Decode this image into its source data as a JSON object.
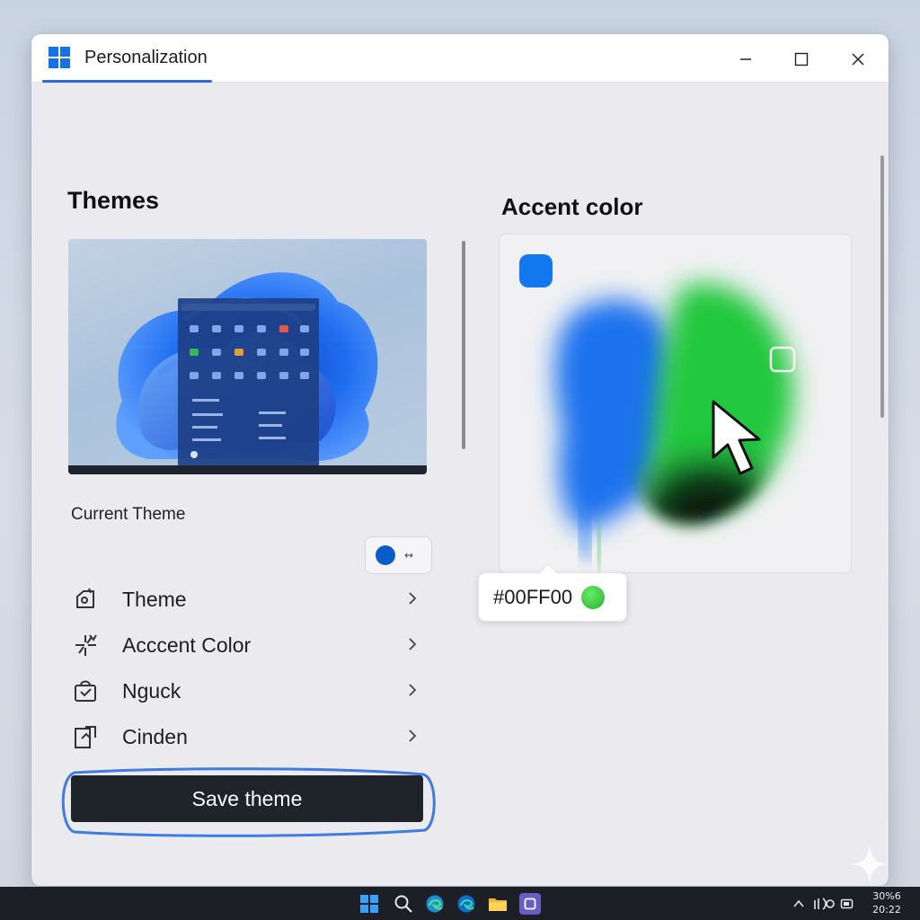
{
  "window": {
    "title": "Personalization"
  },
  "left": {
    "section_title": "Themes",
    "current_theme_label": "Current Theme",
    "chip_color": "#0a5cc9",
    "menu": [
      {
        "label": "Theme",
        "icon": "theme-paint-icon"
      },
      {
        "label": "Acccent Color",
        "icon": "accent-color-icon"
      },
      {
        "label": "Nguck",
        "icon": "bag-icon"
      },
      {
        "label": "Cinden",
        "icon": "window-export-icon"
      }
    ],
    "save_label": "Save theme"
  },
  "right": {
    "section_title": "Accent color",
    "selected_swatch_color": "#1377ee",
    "tooltip_hex": "#00FF00",
    "tooltip_color": "#22b32a"
  },
  "taskbar": {
    "clock_time": "30%6",
    "clock_date": "20:22"
  },
  "colors": {
    "accent_blue": "#2f6bd6",
    "button_dark": "#1f232a",
    "taskbar": "#1c1f26"
  }
}
